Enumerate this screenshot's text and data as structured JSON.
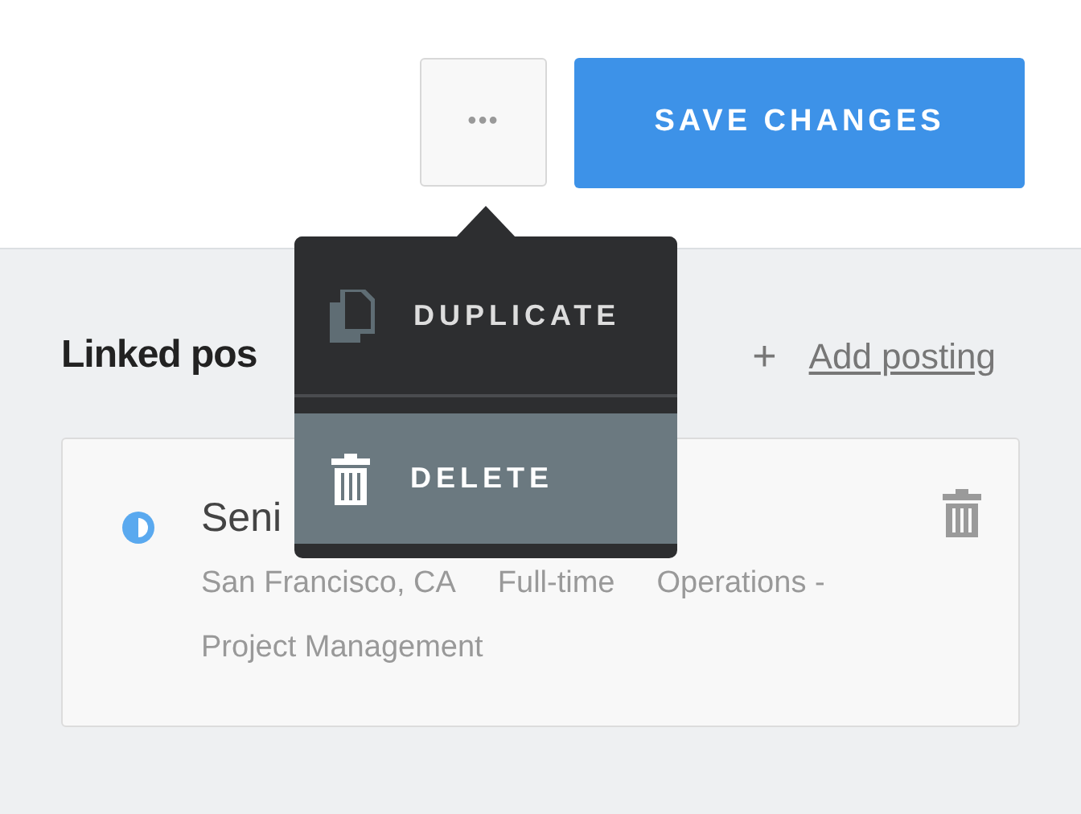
{
  "toolbar": {
    "more_button": "•••",
    "save_button": "SAVE CHANGES"
  },
  "menu": {
    "items": [
      {
        "kind": "duplicate",
        "label": "DUPLICATE",
        "selected": false
      },
      {
        "kind": "delete",
        "label": "DELETE",
        "selected": true
      }
    ]
  },
  "linked_postings": {
    "heading": "Linked pos",
    "add_icon": "+",
    "add_link": "Add posting",
    "postings": [
      {
        "title": "Seni",
        "meta": [
          "San Francisco, CA",
          "Full-time",
          "Operations -",
          "Project Management"
        ]
      }
    ]
  }
}
